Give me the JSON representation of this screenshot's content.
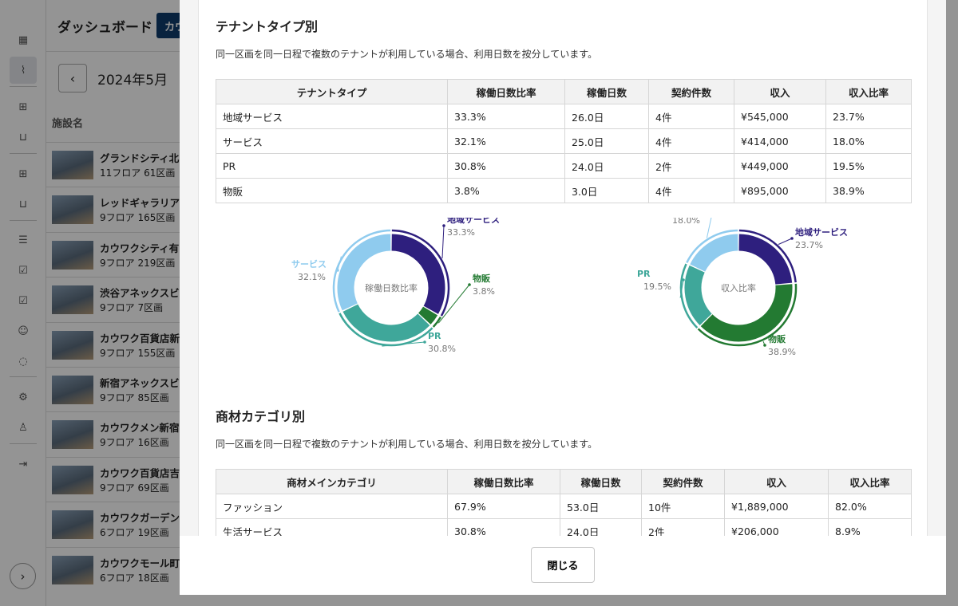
{
  "background": {
    "title": "ダッシュボード",
    "tab_label": "カウ",
    "month": "2024年5月",
    "facility_header": "施設名",
    "facilities": [
      {
        "name": "グランドシティ北",
        "meta": "11フロア 61区画"
      },
      {
        "name": "レッドギャラリア",
        "meta": "9フロア 165区画"
      },
      {
        "name": "カウワクシティ有",
        "meta": "9フロア 219区画"
      },
      {
        "name": "渋谷アネックスビ",
        "meta": "9フロア 7区画"
      },
      {
        "name": "カウワク百貨店新",
        "meta": "9フロア 155区画"
      },
      {
        "name": "新宿アネックスビ",
        "meta": "9フロア 85区画"
      },
      {
        "name": "カウワクメン新宿",
        "meta": "9フロア 16区画"
      },
      {
        "name": "カウワク百貨店吉",
        "meta": "9フロア 69区画"
      },
      {
        "name": "カウワクガーデン",
        "meta": "6フロア 19区画"
      },
      {
        "name": "カウワクモール町",
        "meta": "6フロア 18区画"
      }
    ],
    "rail_icons": [
      "calendar-icon",
      "chart-icon",
      "grid-icon",
      "inbox-icon",
      "grid-icon",
      "inbox-icon",
      "list-icon",
      "document-check-icon",
      "document-check-icon",
      "group-icon",
      "chat-icon",
      "gear-icon",
      "user-icon",
      "logout-icon"
    ]
  },
  "modal": {
    "close_label": "閉じる",
    "tenant": {
      "title": "テナントタイプ別",
      "note": "同一区画を同一日程で複数のテナントが利用している場合、利用日数を按分しています。",
      "headers": [
        "テナントタイプ",
        "稼働日数比率",
        "稼働日数",
        "契約件数",
        "収入",
        "収入比率"
      ],
      "rows": [
        [
          "地域サービス",
          "33.3%",
          "26.0日",
          "4件",
          "¥545,000",
          "23.7%"
        ],
        [
          "サービス",
          "32.1%",
          "25.0日",
          "4件",
          "¥414,000",
          "18.0%"
        ],
        [
          "PR",
          "30.8%",
          "24.0日",
          "2件",
          "¥449,000",
          "19.5%"
        ],
        [
          "物販",
          "3.8%",
          "3.0日",
          "4件",
          "¥895,000",
          "38.9%"
        ]
      ]
    },
    "category": {
      "title": "商材カテゴリ別",
      "note": "同一区画を同一日程で複数のテナントが利用している場合、利用日数を按分しています。",
      "headers": [
        "商材メインカテゴリ",
        "稼働日数比率",
        "稼働日数",
        "契約件数",
        "収入",
        "収入比率"
      ],
      "rows": [
        [
          "ファッション",
          "67.9%",
          "53.0日",
          "10件",
          "¥1,889,000",
          "82.0%"
        ],
        [
          "生活サービス",
          "30.8%",
          "24.0日",
          "2件",
          "¥206,000",
          "8.9%"
        ]
      ]
    }
  },
  "chart_data": [
    {
      "type": "pie",
      "title": "稼働日数比率",
      "categories": [
        "地域サービス",
        "物販",
        "PR",
        "サービス"
      ],
      "values": [
        33.3,
        3.8,
        30.8,
        32.1
      ],
      "colors": [
        "#2e1f7e",
        "#237a32",
        "#3fa79a",
        "#8fcbee"
      ]
    },
    {
      "type": "pie",
      "title": "収入比率",
      "categories": [
        "地域サービス",
        "物販",
        "PR",
        "サービス"
      ],
      "values": [
        23.7,
        38.9,
        19.5,
        18.0
      ],
      "colors": [
        "#2e1f7e",
        "#237a32",
        "#3fa79a",
        "#8fcbee"
      ]
    }
  ]
}
